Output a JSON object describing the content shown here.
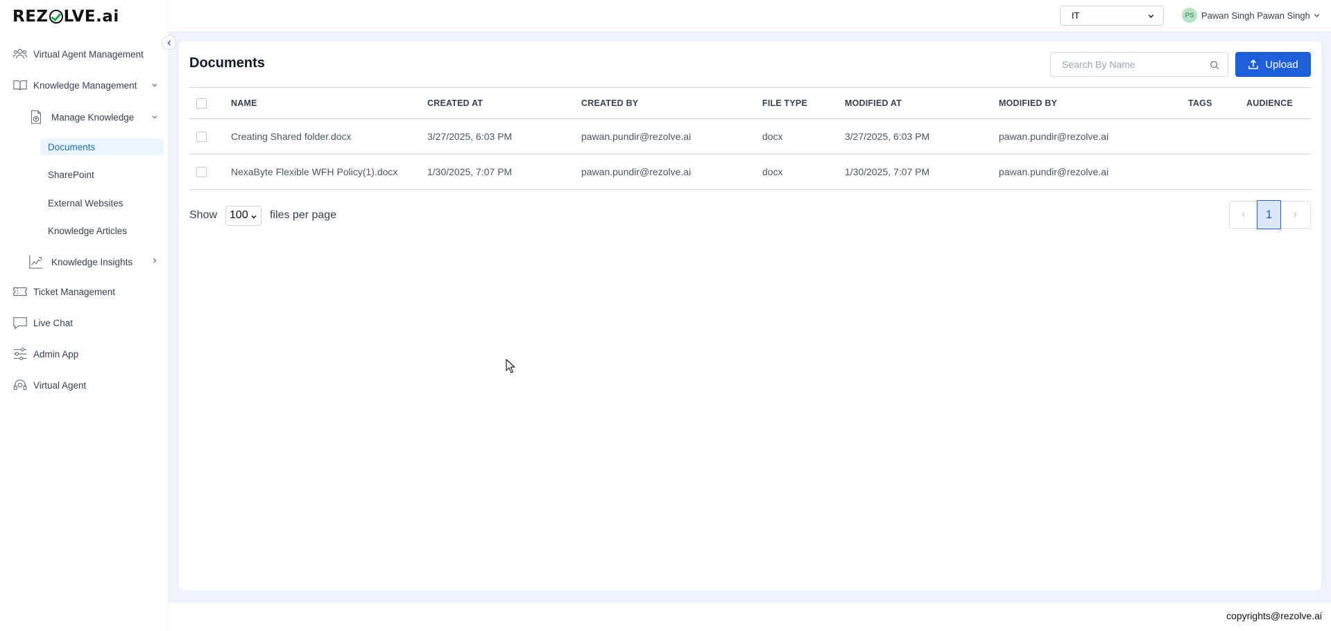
{
  "brand": {
    "logo_left": "REZ",
    "logo_right": "LVE",
    "logo_suffix": ".ai"
  },
  "sidebar": {
    "items": [
      {
        "label": "Virtual Agent Management",
        "icon": "users-icon"
      },
      {
        "label": "Knowledge Management",
        "icon": "book-icon",
        "expanded": true
      },
      {
        "label": "Manage Knowledge",
        "icon": "upload-doc-icon",
        "expanded": true
      },
      {
        "label": "Knowledge Insights",
        "icon": "chart-trend-icon",
        "expanded": false
      },
      {
        "label": "Ticket Management",
        "icon": "ticket-icon"
      },
      {
        "label": "Live Chat",
        "icon": "chat-icon"
      },
      {
        "label": "Admin App",
        "icon": "sliders-icon"
      },
      {
        "label": "Virtual Agent",
        "icon": "headset-icon"
      }
    ],
    "sub_items": [
      {
        "label": "Documents",
        "active": true
      },
      {
        "label": "SharePoint",
        "active": false
      },
      {
        "label": "External Websites",
        "active": false
      },
      {
        "label": "Knowledge Articles",
        "active": false
      }
    ]
  },
  "header": {
    "workspace_select": "IT",
    "user_initials": "PS",
    "user_name": "Pawan Singh Pawan Singh"
  },
  "main": {
    "title": "Documents",
    "search_placeholder": "Search By Name",
    "upload_label": "Upload",
    "columns": [
      "NAME",
      "CREATED AT",
      "CREATED BY",
      "FILE TYPE",
      "MODIFIED AT",
      "MODIFIED BY",
      "TAGS",
      "AUDIENCE"
    ],
    "rows": [
      {
        "name": "Creating Shared folder.docx",
        "created_at": "3/27/2025, 6:03 PM",
        "created_by": "pawan.pundir@rezolve.ai",
        "file_type": "docx",
        "modified_at": "3/27/2025, 6:03 PM",
        "modified_by": "pawan.pundir@rezolve.ai",
        "tags": "",
        "audience": ""
      },
      {
        "name": "NexaByte Flexible WFH Policy(1).docx",
        "created_at": "1/30/2025, 7:07 PM",
        "created_by": "pawan.pundir@rezolve.ai",
        "file_type": "docx",
        "modified_at": "1/30/2025, 7:07 PM",
        "modified_by": "pawan.pundir@rezolve.ai",
        "tags": "",
        "audience": ""
      }
    ],
    "show_label": "Show",
    "per_page_value": "100",
    "per_page_suffix": "files per page",
    "current_page": "1"
  },
  "footer": {
    "text": "copyrights@rezolve.ai"
  },
  "colors": {
    "primary": "#1d5fd8",
    "active_bg": "#eaf4fd",
    "page_bg": "#eef3fb",
    "logo_check": "#16a34a"
  }
}
